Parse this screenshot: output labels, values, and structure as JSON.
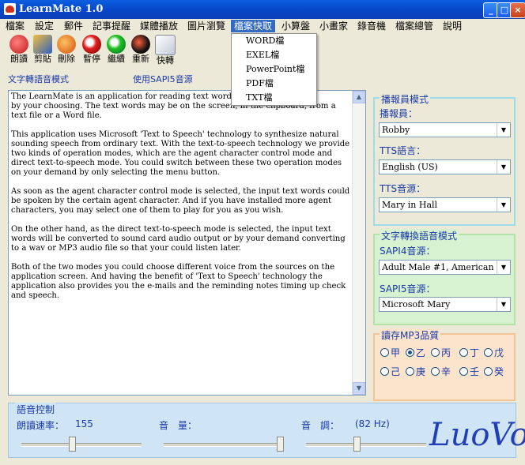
{
  "window": {
    "title": "LearnMate 1.0"
  },
  "menu": [
    "檔案",
    "設定",
    "郵件",
    "記事提醒",
    "媒體播放",
    "圖片瀏覽",
    "檔案快取",
    "小算盤",
    "小畫家",
    "錄音機",
    "檔案總管",
    "說明"
  ],
  "dropdown": [
    "WORD檔",
    "EXEL檔",
    "PowerPoint檔",
    "PDF檔",
    "TXT檔"
  ],
  "toolbar": [
    {
      "label": "朗讀",
      "icon": "read-aloud-icon"
    },
    {
      "label": "剪貼",
      "icon": "clipboard-icon"
    },
    {
      "label": "刪除",
      "icon": "delete-icon"
    },
    {
      "label": "暫停",
      "icon": "pause-icon"
    },
    {
      "label": "繼續",
      "icon": "continue-icon"
    },
    {
      "label": "重新",
      "icon": "restart-icon"
    },
    {
      "label": "快轉",
      "icon": "fast-forward-icon"
    }
  ],
  "mode": {
    "left": "文字轉語音模式",
    "right": "使用SAPI5音源"
  },
  "text_content": "The LearnMate is an application for reading text words to you                                       by your choosing. The text words may be on the screen, in the clipboard, from a text file or a Word file.\n\nThis application uses Microsoft 'Text to Speech' technology to synthesize natural sounding speech from ordinary text. With the text-to-speech technology we provide two kinds of operation modes, which are the agent character control mode and direct text-to-speech mode. You could switch between these two operation modes on your demand by only selecting the menu button.\n\nAs soon as the agent character control mode is selected, the input text words could be spoken by the certain agent character. And if you have installed more agent characters, you may select one of them to play for you as you wish.\n\nOn the other hand, as the direct text-to-speech mode is selected, the input text words will be converted to sound card audio output or by your demand converting to a wav or MP3 audio file so that your could listen later.\n\nBoth of the two modes you could choose different voice from the sources on the application screen. And having the benefit of 'Text to Speech' technology the application also provides you the e-mails and the reminding notes timing up check and speech.",
  "announcer": {
    "caption": "播報員模式",
    "speaker_label": "播報員：",
    "speaker": "Robby",
    "tts_lang_label": "TTS語言：",
    "tts_lang": "English (US)",
    "tts_src_label": "TTS音源：",
    "tts_src": "Mary in Hall"
  },
  "t2s": {
    "caption": "文字轉換語音模式",
    "sapi4_label": "SAPI4音源：",
    "sapi4": "Adult Male #1, American English",
    "sapi5_label": "SAPI5音源：",
    "sapi5": "Microsoft Mary"
  },
  "mp3": {
    "caption": "讀存MP3品質",
    "options": [
      "甲",
      "乙",
      "丙",
      "丁",
      "戊",
      "己",
      "庚",
      "辛",
      "壬",
      "癸"
    ],
    "selected": "乙"
  },
  "voice": {
    "caption": "語音控制",
    "rate_label": "朗讀速率：",
    "rate_value": "155",
    "volume_label": "音　量：",
    "pitch_label": "音　調：",
    "pitch_value": "(82 Hz)",
    "rate_level": 0.42,
    "volume_level": 1.0,
    "pitch_level": 0.42
  },
  "logo": "LuoVoc"
}
